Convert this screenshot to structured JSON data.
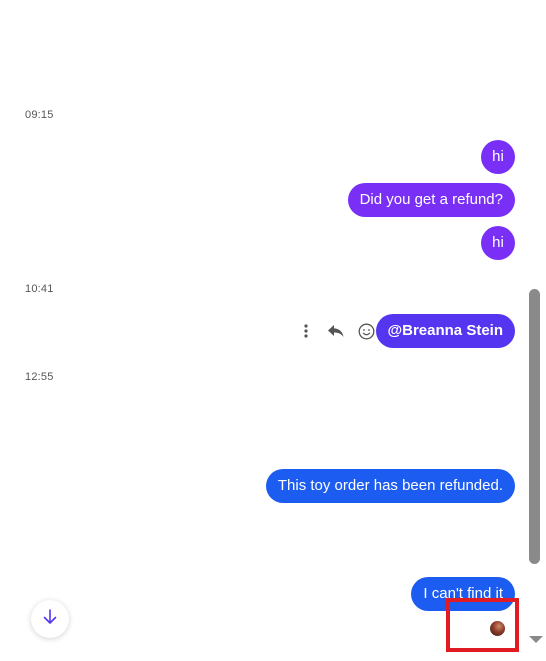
{
  "chat": {
    "timestamps": [
      "09:15",
      "10:41",
      "12:55"
    ],
    "messages": [
      {
        "text": "hi"
      },
      {
        "text": "Did you get a refund?"
      },
      {
        "text": "hi"
      },
      {
        "text": "@Breanna Stein"
      },
      {
        "text": "This toy order has been refunded."
      },
      {
        "text": "I can't find it"
      }
    ]
  },
  "colors": {
    "purple_bubble": "#7a2ff7",
    "mention_bubble": "#5535f0",
    "blue_bubble": "#1c5cf0",
    "highlight": "#e01b24"
  },
  "icons": {
    "more": "more-vertical-icon",
    "reply": "reply-icon",
    "react": "emoji-icon",
    "jump": "arrow-down-icon"
  }
}
